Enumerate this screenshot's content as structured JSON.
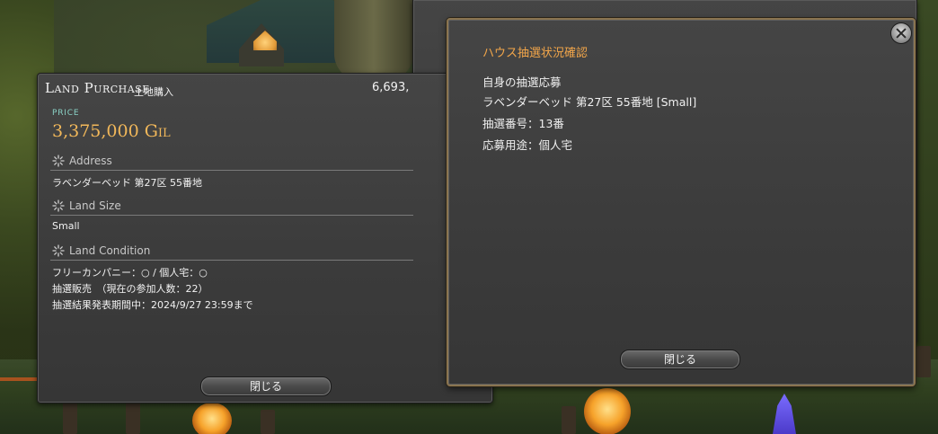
{
  "land_purchase": {
    "title": "Land Purchase",
    "subtitle": "土地購入",
    "gil_total": "6,693,",
    "price_label": "PRICE",
    "price_value": "3,375,000 Gil",
    "sections": {
      "address": {
        "label": "Address",
        "value": "ラベンダーベッド 第27区 55番地"
      },
      "land_size": {
        "label": "Land Size",
        "value": "Small"
      },
      "land_condition": {
        "label": "Land Condition",
        "lines": [
          "フリーカンパニー：○ / 個人宅：○",
          "抽選販売　（現在の参加人数：22）",
          "抽選結果発表期間中：2024/9/27 23:59まで"
        ]
      }
    },
    "close_button": "閉じる"
  },
  "house_lottery": {
    "title": "ハウス抽選状況確認",
    "lines": [
      "自身の抽選応募",
      "ラベンダーベッド 第27区 55番地 [Small]",
      "抽選番号：13番",
      "応募用途：個人宅"
    ],
    "close_button": "閉じる"
  },
  "colors": {
    "price_label": "#8ad2c6",
    "price_value": "#f2b85a",
    "house_title": "#f2a64a",
    "house_border": "#8a7450"
  },
  "icons": {
    "section": "sparkle-icon",
    "window_close": "close-icon"
  }
}
